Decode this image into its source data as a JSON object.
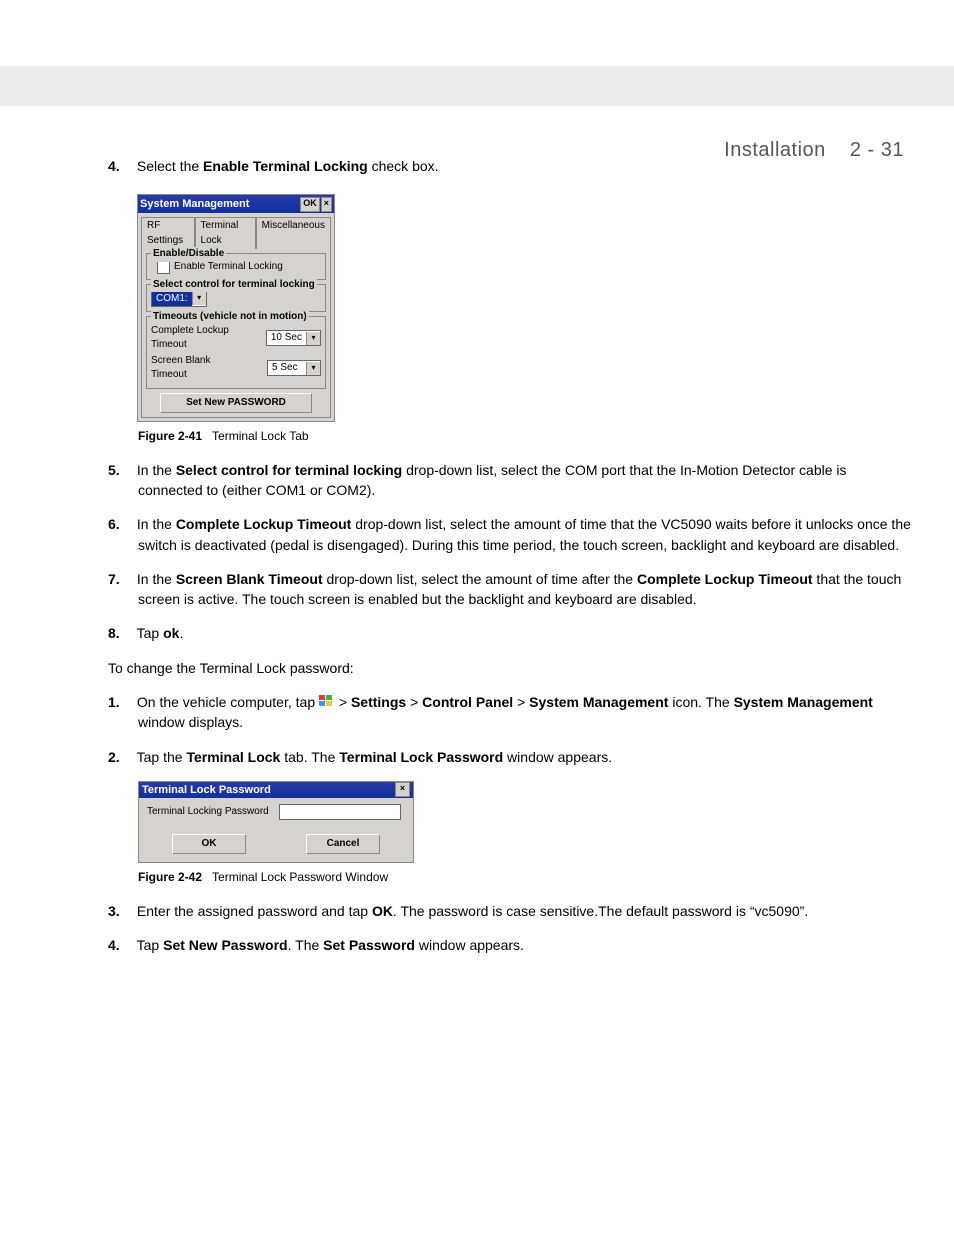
{
  "header": {
    "title": "Installation",
    "section": "2 - 31"
  },
  "step4": {
    "num": "4.",
    "t1": "Select the ",
    "bold": "Enable Terminal Locking",
    "t2": " check box."
  },
  "fig41": {
    "title": "System Management",
    "ok": "OK",
    "close": "×",
    "tabs": [
      "RF Settings",
      "Terminal Lock",
      "Miscellaneous"
    ],
    "grp1": {
      "label": "Enable/Disable",
      "chk": "Enable Terminal Locking"
    },
    "grp2": {
      "label": "Select control for terminal locking",
      "value": "COM1:"
    },
    "grp3": {
      "label": "Timeouts (vehicle not in motion)",
      "r1": {
        "label": "Complete Lockup Timeout",
        "value": "10 Sec"
      },
      "r2": {
        "label": "Screen Blank Timeout",
        "value": "5 Sec"
      }
    },
    "pwdbtn": "Set New PASSWORD",
    "caption": "Figure 2-41",
    "caption2": "Terminal Lock Tab"
  },
  "step5": {
    "num": "5.",
    "t1": "In the ",
    "bold": "Select control for terminal locking",
    "t2": " drop-down list, select the COM port that the In-Motion Detector cable is connected to (either COM1 or COM2)."
  },
  "step6": {
    "num": "6.",
    "t1": "In the ",
    "bold": "Complete Lockup Timeout",
    "t2": " drop-down list, select the amount of time that the VC5090 waits before it unlocks once the switch is deactivated (pedal is disengaged). During this time period, the touch screen, backlight and keyboard are disabled."
  },
  "step7": {
    "num": "7.",
    "t1": "In the ",
    "bold": "Screen Blank Timeout",
    "t2": " drop-down list, select the amount of time after the ",
    "bold2": "Complete Lockup Timeout",
    "t3": " that the touch screen is active. The touch screen is enabled but the backlight and keyboard are disabled."
  },
  "step8": {
    "num": "8.",
    "t1": "Tap ",
    "bold": "ok",
    "t2": "."
  },
  "changepwd": "To change the Terminal Lock password:",
  "stepA": {
    "num": "1.",
    "t1": "On the vehicle computer, tap ",
    "gt": ">",
    "b1": "Settings",
    "b2": "Control Panel",
    "b3": "System Management",
    "t2": " icon. The ",
    "b4": "System Management",
    "t3": " window displays."
  },
  "stepB": {
    "num": "2.",
    "t1": "Tap the ",
    "b1": "Terminal Lock",
    "t2": " tab. The ",
    "b2": "Terminal Lock Password",
    "t3": " window appears."
  },
  "fig42": {
    "title": "Terminal Lock Password",
    "close": "×",
    "label": "Terminal Locking Password",
    "ok": "OK",
    "cancel": "Cancel",
    "caption": "Figure 2-42",
    "caption2": "Terminal Lock Password Window"
  },
  "stepC": {
    "num": "3.",
    "t1": "Enter the assigned password and tap ",
    "bold": "OK",
    "t2": ". The password is case sensitive.The default password is “vc5090”."
  },
  "stepD": {
    "num": "4.",
    "t1": "Tap ",
    "bold": "Set New Password",
    "t2": ". The ",
    "bold2": "Set Password",
    "t3": " window appears."
  }
}
